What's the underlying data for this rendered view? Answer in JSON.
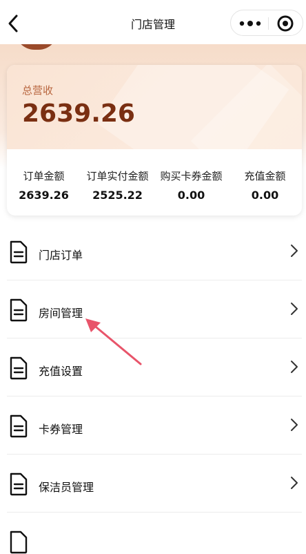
{
  "nav": {
    "title": "门店管理",
    "back_icon": "back-chevron-icon",
    "more_icon": "more-dots-icon",
    "target_icon": "target-icon"
  },
  "revenue": {
    "label": "总营收",
    "value": "2639.26",
    "stats": [
      {
        "label": "订单金额",
        "value": "2639.26"
      },
      {
        "label": "订单实付金额",
        "value": "2525.22"
      },
      {
        "label": "购买卡券金额",
        "value": "0.00"
      },
      {
        "label": "充值金额",
        "value": "0.00"
      }
    ]
  },
  "menu": {
    "items": [
      {
        "label": "门店订单",
        "icon": "document-icon"
      },
      {
        "label": "房间管理",
        "icon": "document-icon"
      },
      {
        "label": "充值设置",
        "icon": "document-icon"
      },
      {
        "label": "卡券管理",
        "icon": "document-icon"
      },
      {
        "label": "保洁员管理",
        "icon": "document-icon"
      }
    ]
  },
  "colors": {
    "accent": "#7a2f12",
    "label_brown": "#b8663f",
    "peach": "#f6dcc9",
    "annotation": "#e8546a"
  }
}
